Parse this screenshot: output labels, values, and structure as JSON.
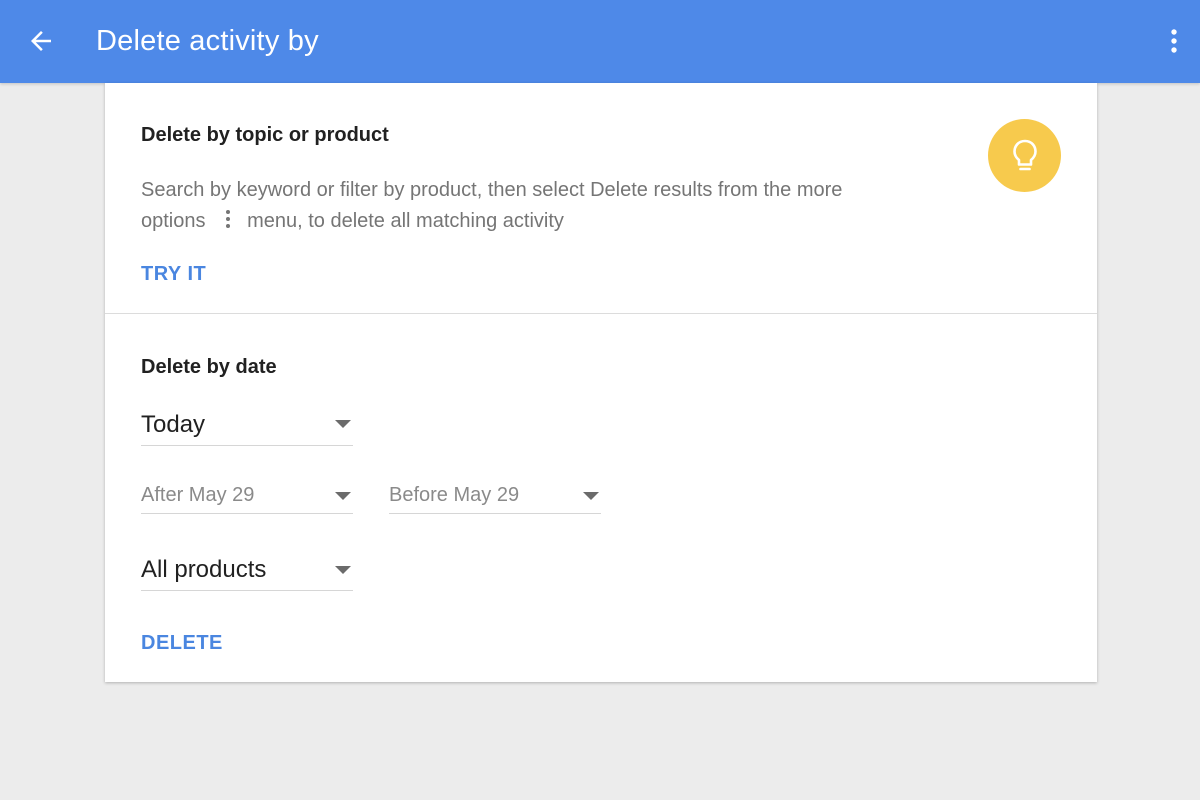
{
  "header": {
    "title": "Delete activity by",
    "back_icon": "arrow-back-icon",
    "more_icon": "more-vert-icon",
    "color": "#4e89e8"
  },
  "topic_section": {
    "heading": "Delete by topic or product",
    "description_part1": "Search by keyword or filter by product, then select Delete results from the more options",
    "description_part2": "menu, to delete all matching activity",
    "inline_icon": "more-vert-icon",
    "action_label": "TRY IT",
    "illustration_icon": "lightbulb-icon",
    "illustration_color": "#f7ca4d"
  },
  "date_section": {
    "heading": "Delete by date",
    "range_select": {
      "value": "Today"
    },
    "after_select": {
      "value": "After May 29"
    },
    "before_select": {
      "value": "Before May 29"
    },
    "product_select": {
      "value": "All products"
    },
    "action_label": "DELETE"
  },
  "colors": {
    "accent": "#4a86e0",
    "background": "#ececec"
  }
}
